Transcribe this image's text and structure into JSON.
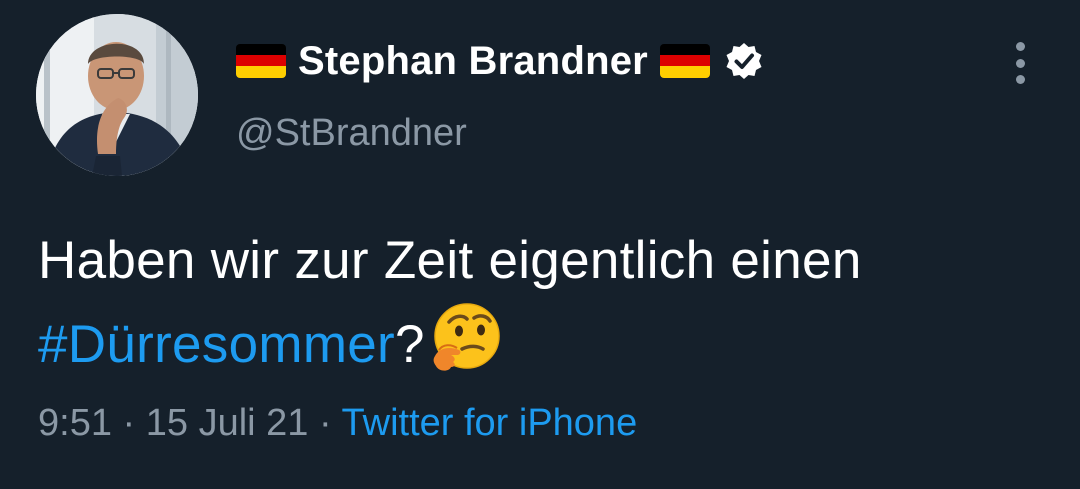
{
  "author": {
    "display_name": "Stephan Brandner",
    "handle": "@StBrandner",
    "verified": true,
    "flag_icon": "germany-flag-icon"
  },
  "tweet": {
    "text_main": "Haben wir zur Zeit eigentlich einen",
    "hashtag": "#Dürresommer",
    "text_after": "?",
    "emoji": "thinking-face-icon"
  },
  "meta": {
    "time": "9:51",
    "separator": "·",
    "date": "15 Juli 21",
    "source": "Twitter for iPhone"
  },
  "colors": {
    "background": "#15202b",
    "text": "#ffffff",
    "secondary": "#8b98a5",
    "accent": "#1d9bf0"
  }
}
